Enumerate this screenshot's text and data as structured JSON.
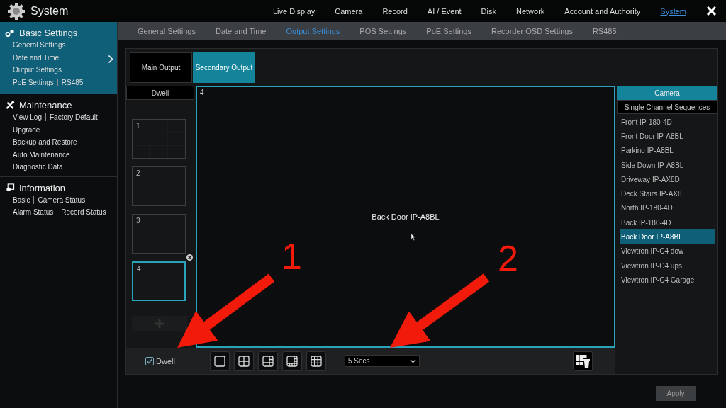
{
  "window": {
    "title": "System"
  },
  "top_nav": [
    {
      "label": "Live Display",
      "selected": false
    },
    {
      "label": "Camera",
      "selected": false
    },
    {
      "label": "Record",
      "selected": false
    },
    {
      "label": "AI / Event",
      "selected": false
    },
    {
      "label": "Disk",
      "selected": false
    },
    {
      "label": "Network",
      "selected": false
    },
    {
      "label": "Account and Authority",
      "selected": false
    },
    {
      "label": "System",
      "selected": true
    }
  ],
  "sidebar": {
    "sections": [
      {
        "kind": "basic",
        "title": "Basic Settings",
        "selected": true,
        "rows": [
          [
            "General Settings"
          ],
          [
            "Date and Time"
          ],
          [
            "Output Settings"
          ],
          [
            "PoE Settings",
            "RS485"
          ]
        ]
      },
      {
        "kind": "maintenance",
        "title": "Maintenance",
        "selected": false,
        "rows": [
          [
            "View Log",
            "Factory Default"
          ],
          [
            "Upgrade"
          ],
          [
            "Backup and Restore"
          ],
          [
            "Auto Maintenance"
          ],
          [
            "Diagnostic Data"
          ]
        ]
      },
      {
        "kind": "information",
        "title": "Information",
        "selected": false,
        "rows": [
          [
            "Basic",
            "Camera Status"
          ],
          [
            "Alarm Status",
            "Record Status"
          ]
        ]
      }
    ]
  },
  "sub_tabs": [
    {
      "label": "General Settings",
      "selected": false
    },
    {
      "label": "Date and Time",
      "selected": false
    },
    {
      "label": "Output Settings",
      "selected": true
    },
    {
      "label": "POS Settings",
      "selected": false
    },
    {
      "label": "PoE Settings",
      "selected": false
    },
    {
      "label": "Recorder OSD Settings",
      "selected": false
    },
    {
      "label": "RS485",
      "selected": false
    }
  ],
  "output_tabs": [
    {
      "label": "Main Output",
      "selected": false
    },
    {
      "label": "Secondary Output",
      "selected": true
    }
  ],
  "sequence": {
    "header": "Dwell",
    "thumbs": [
      {
        "label": "1",
        "kind": "six",
        "selected": false
      },
      {
        "label": "2",
        "kind": "single",
        "selected": false
      },
      {
        "label": "3",
        "kind": "single",
        "selected": false
      },
      {
        "label": "4",
        "kind": "single",
        "selected": true
      }
    ]
  },
  "view": {
    "channel": "4",
    "camera": "Back Door IP-A8BL"
  },
  "dwell": {
    "label": "Dwell",
    "checked": true
  },
  "layout_buttons": [
    {
      "kind": "single"
    },
    {
      "kind": "quad"
    },
    {
      "kind": "six"
    },
    {
      "kind": "eight"
    },
    {
      "kind": "nine"
    }
  ],
  "dwell_time": {
    "value": "5 Secs"
  },
  "camera_panel": {
    "header": "Camera",
    "sub_header": "Single Channel Sequences",
    "items": [
      {
        "label": "Front IP-180-4D",
        "selected": false
      },
      {
        "label": "Front Door IP-A8BL",
        "selected": false
      },
      {
        "label": "Parking IP-A8BL",
        "selected": false
      },
      {
        "label": "Side Down IP-A8BL",
        "selected": false
      },
      {
        "label": "Driveway IP-AX8D",
        "selected": false
      },
      {
        "label": "Deck Stairs IP-AX8",
        "selected": false
      },
      {
        "label": "North IP-180-4D",
        "selected": false
      },
      {
        "label": "Back IP-180-4D",
        "selected": false
      },
      {
        "label": "Back Door IP-A8BL",
        "selected": true
      },
      {
        "label": "Viewtron IP-C4 dow",
        "selected": false
      },
      {
        "label": "Viewtron IP-C4 ups",
        "selected": false
      },
      {
        "label": "Viewtron IP-C4 Garage",
        "selected": false
      }
    ]
  },
  "apply": "Apply",
  "annotations": [
    {
      "label": "1"
    },
    {
      "label": "2"
    }
  ]
}
